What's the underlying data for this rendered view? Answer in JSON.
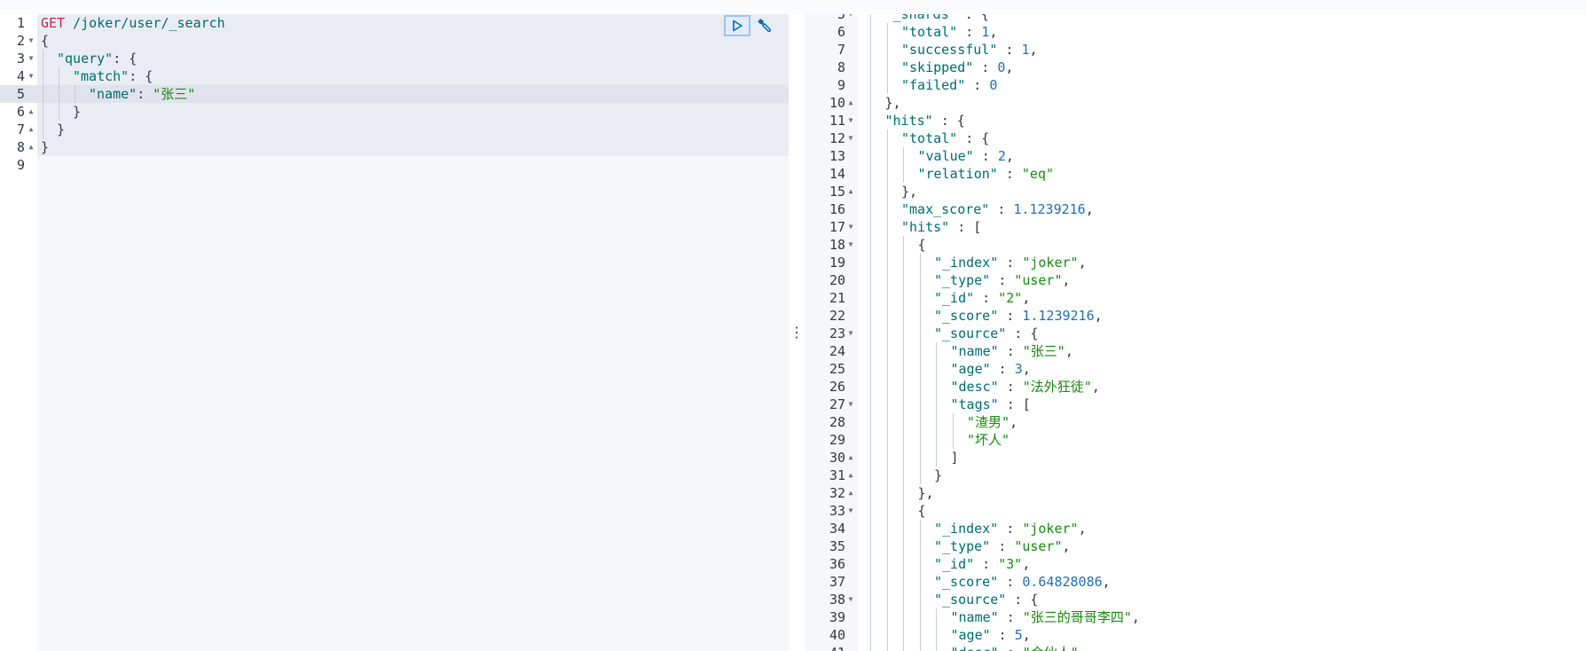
{
  "request": {
    "run_action": "run-request",
    "wrench_action": "request-settings",
    "lines": [
      {
        "n": "1",
        "fold": "",
        "tokens": [
          {
            "t": "GET",
            "c": "k-method"
          },
          {
            "t": " /joker/user/_search",
            "c": "k-url"
          }
        ],
        "indent": 0
      },
      {
        "n": "2",
        "fold": "▼",
        "tokens": [
          {
            "t": "{",
            "c": "k-punc"
          }
        ],
        "indent": 0
      },
      {
        "n": "3",
        "fold": "▼",
        "tokens": [
          {
            "t": "\"query\"",
            "c": "k-key"
          },
          {
            "t": ": {",
            "c": "k-punc"
          }
        ],
        "indent": 1
      },
      {
        "n": "4",
        "fold": "▼",
        "tokens": [
          {
            "t": "\"match\"",
            "c": "k-key"
          },
          {
            "t": ": {",
            "c": "k-punc"
          }
        ],
        "indent": 2
      },
      {
        "n": "5",
        "fold": "",
        "tokens": [
          {
            "t": "\"name\"",
            "c": "k-key"
          },
          {
            "t": ": ",
            "c": "k-punc"
          },
          {
            "t": "\"张三\"",
            "c": "k-str"
          }
        ],
        "indent": 3
      },
      {
        "n": "6",
        "fold": "▲",
        "tokens": [
          {
            "t": "}",
            "c": "k-punc"
          }
        ],
        "indent": 2
      },
      {
        "n": "7",
        "fold": "▲",
        "tokens": [
          {
            "t": "}",
            "c": "k-punc"
          }
        ],
        "indent": 1
      },
      {
        "n": "8",
        "fold": "▲",
        "tokens": [
          {
            "t": "}",
            "c": "k-punc"
          }
        ],
        "indent": 0
      },
      {
        "n": "9",
        "fold": "",
        "tokens": [],
        "indent": 0
      }
    ]
  },
  "response": {
    "lines": [
      {
        "n": "5",
        "fold": "▼",
        "tokens": [
          {
            "t": "\"_shards\"",
            "c": "k-key"
          },
          {
            "t": " : {",
            "c": "k-punc"
          }
        ],
        "indent": 1
      },
      {
        "n": "6",
        "fold": "",
        "tokens": [
          {
            "t": "\"total\"",
            "c": "k-key"
          },
          {
            "t": " : ",
            "c": "k-punc"
          },
          {
            "t": "1",
            "c": "k-num"
          },
          {
            "t": ",",
            "c": "k-punc"
          }
        ],
        "indent": 2
      },
      {
        "n": "7",
        "fold": "",
        "tokens": [
          {
            "t": "\"successful\"",
            "c": "k-key"
          },
          {
            "t": " : ",
            "c": "k-punc"
          },
          {
            "t": "1",
            "c": "k-num"
          },
          {
            "t": ",",
            "c": "k-punc"
          }
        ],
        "indent": 2
      },
      {
        "n": "8",
        "fold": "",
        "tokens": [
          {
            "t": "\"skipped\"",
            "c": "k-key"
          },
          {
            "t": " : ",
            "c": "k-punc"
          },
          {
            "t": "0",
            "c": "k-num"
          },
          {
            "t": ",",
            "c": "k-punc"
          }
        ],
        "indent": 2
      },
      {
        "n": "9",
        "fold": "",
        "tokens": [
          {
            "t": "\"failed\"",
            "c": "k-key"
          },
          {
            "t": " : ",
            "c": "k-punc"
          },
          {
            "t": "0",
            "c": "k-num"
          }
        ],
        "indent": 2
      },
      {
        "n": "10",
        "fold": "▲",
        "tokens": [
          {
            "t": "},",
            "c": "k-punc"
          }
        ],
        "indent": 1
      },
      {
        "n": "11",
        "fold": "▼",
        "tokens": [
          {
            "t": "\"hits\"",
            "c": "k-key"
          },
          {
            "t": " : {",
            "c": "k-punc"
          }
        ],
        "indent": 1
      },
      {
        "n": "12",
        "fold": "▼",
        "tokens": [
          {
            "t": "\"total\"",
            "c": "k-key"
          },
          {
            "t": " : {",
            "c": "k-punc"
          }
        ],
        "indent": 2
      },
      {
        "n": "13",
        "fold": "",
        "tokens": [
          {
            "t": "\"value\"",
            "c": "k-key"
          },
          {
            "t": " : ",
            "c": "k-punc"
          },
          {
            "t": "2",
            "c": "k-num"
          },
          {
            "t": ",",
            "c": "k-punc"
          }
        ],
        "indent": 3
      },
      {
        "n": "14",
        "fold": "",
        "tokens": [
          {
            "t": "\"relation\"",
            "c": "k-key"
          },
          {
            "t": " : ",
            "c": "k-punc"
          },
          {
            "t": "\"eq\"",
            "c": "k-str"
          }
        ],
        "indent": 3
      },
      {
        "n": "15",
        "fold": "▲",
        "tokens": [
          {
            "t": "},",
            "c": "k-punc"
          }
        ],
        "indent": 2
      },
      {
        "n": "16",
        "fold": "",
        "tokens": [
          {
            "t": "\"max_score\"",
            "c": "k-key"
          },
          {
            "t": " : ",
            "c": "k-punc"
          },
          {
            "t": "1.1239216",
            "c": "k-num"
          },
          {
            "t": ",",
            "c": "k-punc"
          }
        ],
        "indent": 2
      },
      {
        "n": "17",
        "fold": "▼",
        "tokens": [
          {
            "t": "\"hits\"",
            "c": "k-key"
          },
          {
            "t": " : [",
            "c": "k-punc"
          }
        ],
        "indent": 2
      },
      {
        "n": "18",
        "fold": "▼",
        "tokens": [
          {
            "t": "{",
            "c": "k-punc"
          }
        ],
        "indent": 3
      },
      {
        "n": "19",
        "fold": "",
        "tokens": [
          {
            "t": "\"_index\"",
            "c": "k-key"
          },
          {
            "t": " : ",
            "c": "k-punc"
          },
          {
            "t": "\"joker\"",
            "c": "k-str"
          },
          {
            "t": ",",
            "c": "k-punc"
          }
        ],
        "indent": 4
      },
      {
        "n": "20",
        "fold": "",
        "tokens": [
          {
            "t": "\"_type\"",
            "c": "k-key"
          },
          {
            "t": " : ",
            "c": "k-punc"
          },
          {
            "t": "\"user\"",
            "c": "k-str"
          },
          {
            "t": ",",
            "c": "k-punc"
          }
        ],
        "indent": 4
      },
      {
        "n": "21",
        "fold": "",
        "tokens": [
          {
            "t": "\"_id\"",
            "c": "k-key"
          },
          {
            "t": " : ",
            "c": "k-punc"
          },
          {
            "t": "\"2\"",
            "c": "k-str"
          },
          {
            "t": ",",
            "c": "k-punc"
          }
        ],
        "indent": 4
      },
      {
        "n": "22",
        "fold": "",
        "tokens": [
          {
            "t": "\"_score\"",
            "c": "k-key"
          },
          {
            "t": " : ",
            "c": "k-punc"
          },
          {
            "t": "1.1239216",
            "c": "k-num"
          },
          {
            "t": ",",
            "c": "k-punc"
          }
        ],
        "indent": 4
      },
      {
        "n": "23",
        "fold": "▼",
        "tokens": [
          {
            "t": "\"_source\"",
            "c": "k-key"
          },
          {
            "t": " : {",
            "c": "k-punc"
          }
        ],
        "indent": 4
      },
      {
        "n": "24",
        "fold": "",
        "tokens": [
          {
            "t": "\"name\"",
            "c": "k-key"
          },
          {
            "t": " : ",
            "c": "k-punc"
          },
          {
            "t": "\"张三\"",
            "c": "k-str"
          },
          {
            "t": ",",
            "c": "k-punc"
          }
        ],
        "indent": 5
      },
      {
        "n": "25",
        "fold": "",
        "tokens": [
          {
            "t": "\"age\"",
            "c": "k-key"
          },
          {
            "t": " : ",
            "c": "k-punc"
          },
          {
            "t": "3",
            "c": "k-num"
          },
          {
            "t": ",",
            "c": "k-punc"
          }
        ],
        "indent": 5
      },
      {
        "n": "26",
        "fold": "",
        "tokens": [
          {
            "t": "\"desc\"",
            "c": "k-key"
          },
          {
            "t": " : ",
            "c": "k-punc"
          },
          {
            "t": "\"法外狂徒\"",
            "c": "k-str"
          },
          {
            "t": ",",
            "c": "k-punc"
          }
        ],
        "indent": 5
      },
      {
        "n": "27",
        "fold": "▼",
        "tokens": [
          {
            "t": "\"tags\"",
            "c": "k-key"
          },
          {
            "t": " : [",
            "c": "k-punc"
          }
        ],
        "indent": 5
      },
      {
        "n": "28",
        "fold": "",
        "tokens": [
          {
            "t": "\"渣男\"",
            "c": "k-str"
          },
          {
            "t": ",",
            "c": "k-punc"
          }
        ],
        "indent": 6
      },
      {
        "n": "29",
        "fold": "",
        "tokens": [
          {
            "t": "\"坏人\"",
            "c": "k-str"
          }
        ],
        "indent": 6
      },
      {
        "n": "30",
        "fold": "▲",
        "tokens": [
          {
            "t": "]",
            "c": "k-punc"
          }
        ],
        "indent": 5
      },
      {
        "n": "31",
        "fold": "▲",
        "tokens": [
          {
            "t": "}",
            "c": "k-punc"
          }
        ],
        "indent": 4
      },
      {
        "n": "32",
        "fold": "▲",
        "tokens": [
          {
            "t": "},",
            "c": "k-punc"
          }
        ],
        "indent": 3
      },
      {
        "n": "33",
        "fold": "▼",
        "tokens": [
          {
            "t": "{",
            "c": "k-punc"
          }
        ],
        "indent": 3
      },
      {
        "n": "34",
        "fold": "",
        "tokens": [
          {
            "t": "\"_index\"",
            "c": "k-key"
          },
          {
            "t": " : ",
            "c": "k-punc"
          },
          {
            "t": "\"joker\"",
            "c": "k-str"
          },
          {
            "t": ",",
            "c": "k-punc"
          }
        ],
        "indent": 4
      },
      {
        "n": "35",
        "fold": "",
        "tokens": [
          {
            "t": "\"_type\"",
            "c": "k-key"
          },
          {
            "t": " : ",
            "c": "k-punc"
          },
          {
            "t": "\"user\"",
            "c": "k-str"
          },
          {
            "t": ",",
            "c": "k-punc"
          }
        ],
        "indent": 4
      },
      {
        "n": "36",
        "fold": "",
        "tokens": [
          {
            "t": "\"_id\"",
            "c": "k-key"
          },
          {
            "t": " : ",
            "c": "k-punc"
          },
          {
            "t": "\"3\"",
            "c": "k-str"
          },
          {
            "t": ",",
            "c": "k-punc"
          }
        ],
        "indent": 4
      },
      {
        "n": "37",
        "fold": "",
        "tokens": [
          {
            "t": "\"_score\"",
            "c": "k-key"
          },
          {
            "t": " : ",
            "c": "k-punc"
          },
          {
            "t": "0.64828086",
            "c": "k-num"
          },
          {
            "t": ",",
            "c": "k-punc"
          }
        ],
        "indent": 4
      },
      {
        "n": "38",
        "fold": "▼",
        "tokens": [
          {
            "t": "\"_source\"",
            "c": "k-key"
          },
          {
            "t": " : {",
            "c": "k-punc"
          }
        ],
        "indent": 4
      },
      {
        "n": "39",
        "fold": "",
        "tokens": [
          {
            "t": "\"name\"",
            "c": "k-key"
          },
          {
            "t": " : ",
            "c": "k-punc"
          },
          {
            "t": "\"张三的哥哥李四\"",
            "c": "k-str"
          },
          {
            "t": ",",
            "c": "k-punc"
          }
        ],
        "indent": 5
      },
      {
        "n": "40",
        "fold": "",
        "tokens": [
          {
            "t": "\"age\"",
            "c": "k-key"
          },
          {
            "t": " : ",
            "c": "k-punc"
          },
          {
            "t": "5",
            "c": "k-num"
          },
          {
            "t": ",",
            "c": "k-punc"
          }
        ],
        "indent": 5
      },
      {
        "n": "41",
        "fold": "",
        "tokens": [
          {
            "t": "\"desc\"",
            "c": "k-key"
          },
          {
            "t": " : ",
            "c": "k-punc"
          },
          {
            "t": "\"合伙人\"",
            "c": "k-str"
          },
          {
            "t": ",",
            "c": "k-punc"
          }
        ],
        "indent": 5
      }
    ]
  },
  "colors": {
    "method": "#c7254e",
    "key": "#006b73",
    "string": "#178a0f",
    "number": "#1f6fb4"
  }
}
